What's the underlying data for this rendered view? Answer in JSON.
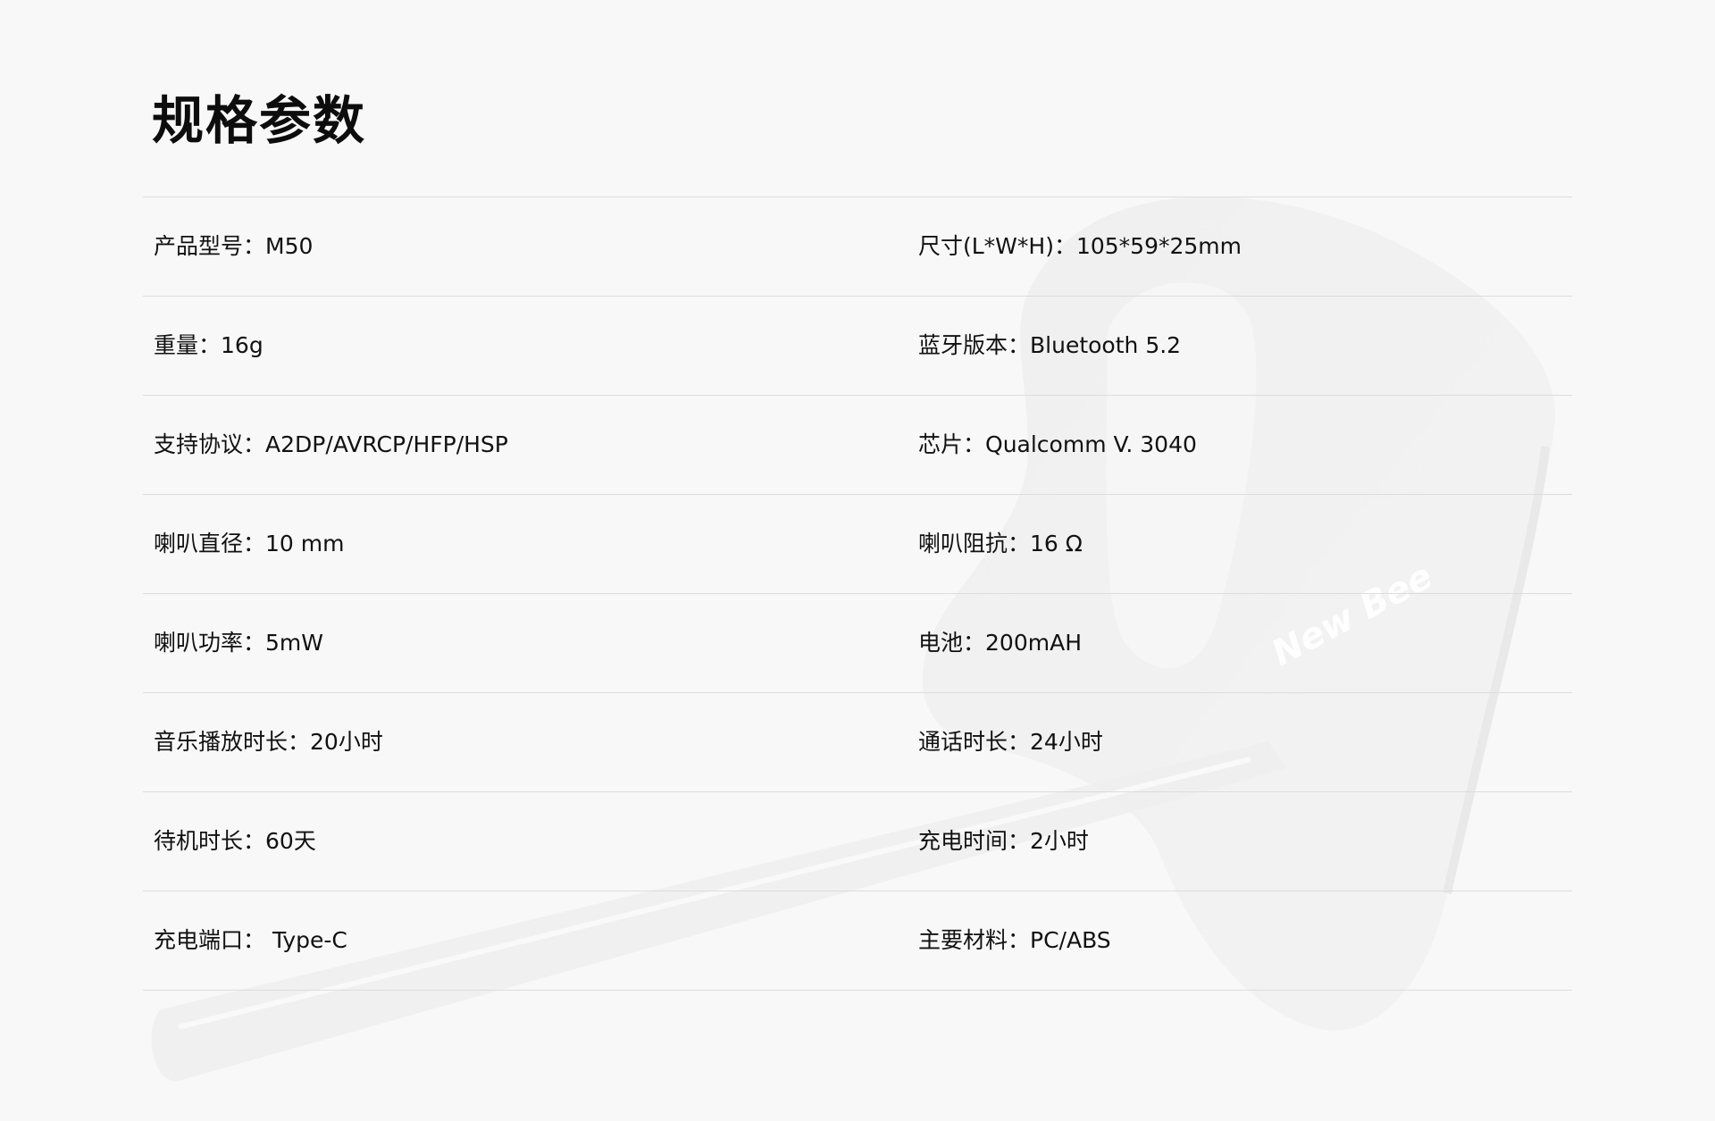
{
  "title": "规格参数",
  "watermark": {
    "brand_text": "New Bee"
  },
  "specs": [
    {
      "left": {
        "label": "产品型号：",
        "value": "M50"
      },
      "right": {
        "label": "尺寸(L*W*H)：",
        "value": "105*59*25mm"
      }
    },
    {
      "left": {
        "label": "重量：",
        "value": "16g"
      },
      "right": {
        "label": "蓝牙版本：",
        "value": "Bluetooth 5.2"
      }
    },
    {
      "left": {
        "label": "支持协议：",
        "value": "A2DP/AVRCP/HFP/HSP"
      },
      "right": {
        "label": "芯片：",
        "value": "Qualcomm V. 3040"
      }
    },
    {
      "left": {
        "label": "喇叭直径：",
        "value": "10 mm"
      },
      "right": {
        "label": "喇叭阻抗：",
        "value": "16 Ω"
      }
    },
    {
      "left": {
        "label": "喇叭功率：",
        "value": "5mW"
      },
      "right": {
        "label": "电池：",
        "value": "200mAH"
      }
    },
    {
      "left": {
        "label": "音乐播放时长：",
        "value": "20小时"
      },
      "right": {
        "label": "通话时长：",
        "value": "24小时"
      }
    },
    {
      "left": {
        "label": "待机时长：",
        "value": "60天"
      },
      "right": {
        "label": "充电时间：",
        "value": "2小时"
      }
    },
    {
      "left": {
        "label": "充电端口：",
        "value": " Type-C"
      },
      "right": {
        "label": "主要材料：",
        "value": "PC/ABS"
      }
    }
  ]
}
